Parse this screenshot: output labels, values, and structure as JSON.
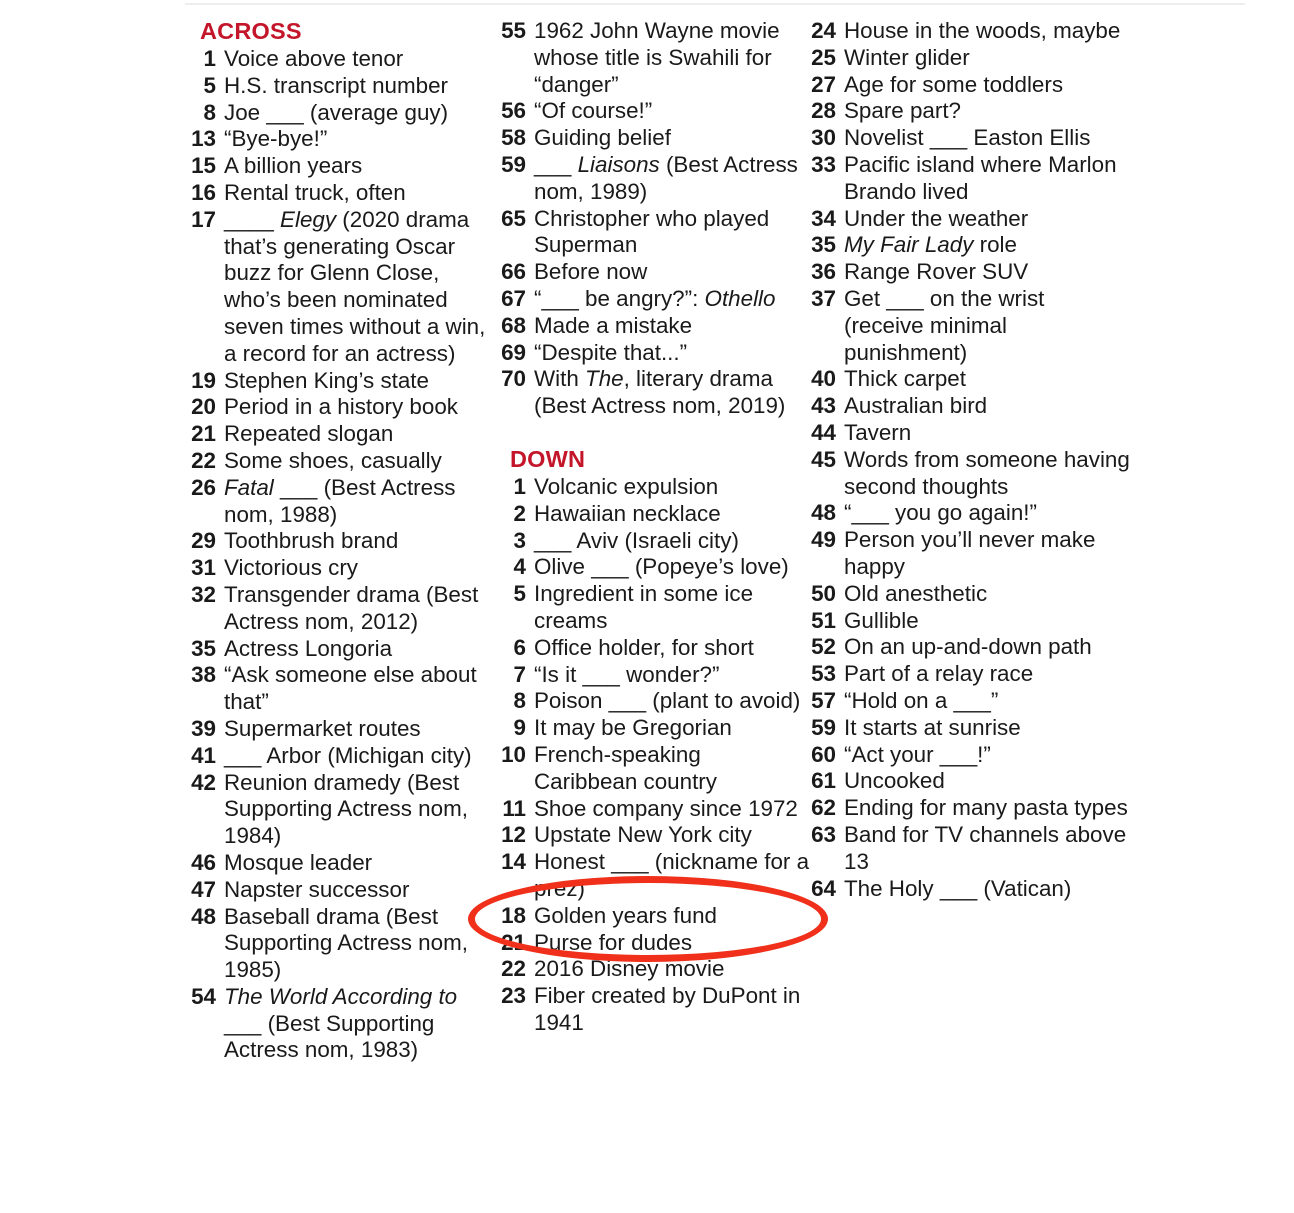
{
  "document": {
    "type": "crossword-clue-list",
    "accent_color": "#C4162B",
    "highlight_color": "#F0301A",
    "text_color": "#1a1a1a",
    "background_color": "#ffffff"
  },
  "columns": [
    {
      "id": "column-1",
      "sections": [
        {
          "heading": "ACROSS",
          "clues": [
            {
              "num": "1",
              "text": "Voice above tenor"
            },
            {
              "num": "5",
              "text": "H.S. transcript number"
            },
            {
              "num": "8",
              "text": "Joe ___ (average guy)"
            },
            {
              "num": "13",
              "text": "“Bye-bye!”"
            },
            {
              "num": "15",
              "text": "A billion years"
            },
            {
              "num": "16",
              "text": "Rental truck, often"
            },
            {
              "num": "17",
              "text": "____ Elegy (2020 drama that’s generating Oscar buzz for Glenn Close, who’s been nominated seven times without a win, a record for an actress)",
              "italic": "Elegy"
            },
            {
              "num": "19",
              "text": "Stephen King’s state"
            },
            {
              "num": "20",
              "text": "Period in a history book"
            },
            {
              "num": "21",
              "text": "Repeated slogan"
            },
            {
              "num": "22",
              "text": "Some shoes, casually"
            },
            {
              "num": "26",
              "text": "Fatal ___ (Best Actress nom, 1988)",
              "italic": "Fatal"
            },
            {
              "num": "29",
              "text": "Toothbrush brand"
            },
            {
              "num": "31",
              "text": "Victorious cry"
            },
            {
              "num": "32",
              "text": "Transgender drama (Best Actress nom, 2012)"
            },
            {
              "num": "35",
              "text": "Actress Longoria"
            },
            {
              "num": "38",
              "text": "“Ask someone else about that”"
            },
            {
              "num": "39",
              "text": "Supermarket routes"
            },
            {
              "num": "41",
              "text": "___ Arbor (Michigan city)"
            },
            {
              "num": "42",
              "text": "Reunion dramedy (Best Supporting Actress nom, 1984)"
            },
            {
              "num": "46",
              "text": "Mosque leader"
            },
            {
              "num": "47",
              "text": "Napster successor"
            },
            {
              "num": "48",
              "text": "Baseball drama (Best Supporting Actress nom, 1985)"
            },
            {
              "num": "54",
              "text": "The World According to ___ (Best Supporting Actress nom, 1983)",
              "italic": "The World According to"
            }
          ]
        }
      ]
    },
    {
      "id": "column-2",
      "sections": [
        {
          "heading": "",
          "clues": [
            {
              "num": "55",
              "text": "1962 John Wayne movie whose title is Swahili for “danger”"
            },
            {
              "num": "56",
              "text": "“Of course!”"
            },
            {
              "num": "58",
              "text": "Guiding belief"
            },
            {
              "num": "59",
              "text": "___ Liaisons (Best Actress nom, 1989)",
              "italic": "Liaisons"
            },
            {
              "num": "65",
              "text": "Christopher who played Superman"
            },
            {
              "num": "66",
              "text": "Before now"
            },
            {
              "num": "67",
              "text": "“___ be angry?”: Othello",
              "italic": "Othello"
            },
            {
              "num": "68",
              "text": "Made a mistake"
            },
            {
              "num": "69",
              "text": "“Despite that...”"
            },
            {
              "num": "70",
              "text": "With The, literary drama (Best Actress nom, 2019)",
              "italic": "The"
            }
          ]
        },
        {
          "heading": "DOWN",
          "clues": [
            {
              "num": "1",
              "text": "Volcanic expulsion"
            },
            {
              "num": "2",
              "text": "Hawaiian necklace"
            },
            {
              "num": "3",
              "text": "___ Aviv (Israeli city)"
            },
            {
              "num": "4",
              "text": "Olive ___ (Popeye’s love)"
            },
            {
              "num": "5",
              "text": "Ingredient in some ice creams"
            },
            {
              "num": "6",
              "text": "Office holder, for short"
            },
            {
              "num": "7",
              "text": "“Is it ___ wonder?”"
            },
            {
              "num": "8",
              "text": "Poison ___ (plant to avoid)"
            },
            {
              "num": "9",
              "text": "It may be Gregorian"
            },
            {
              "num": "10",
              "text": "French-speaking Caribbean country"
            },
            {
              "num": "11",
              "text": "Shoe company since 1972",
              "highlighted": true
            },
            {
              "num": "12",
              "text": "Upstate New York city"
            },
            {
              "num": "14",
              "text": "Honest ___ (nickname for a prez)"
            },
            {
              "num": "18",
              "text": "Golden years fund"
            },
            {
              "num": "21",
              "text": "Purse for dudes"
            },
            {
              "num": "22",
              "text": "2016 Disney movie"
            },
            {
              "num": "23",
              "text": "Fiber created by DuPont in 1941"
            }
          ]
        }
      ]
    },
    {
      "id": "column-3",
      "sections": [
        {
          "heading": "",
          "clues": [
            {
              "num": "24",
              "text": "House in the woods, maybe"
            },
            {
              "num": "25",
              "text": "Winter glider"
            },
            {
              "num": "27",
              "text": "Age for some toddlers"
            },
            {
              "num": "28",
              "text": "Spare part?"
            },
            {
              "num": "30",
              "text": "Novelist ___ Easton Ellis"
            },
            {
              "num": "33",
              "text": "Pacific island where Marlon Brando lived"
            },
            {
              "num": "34",
              "text": "Under the weather"
            },
            {
              "num": "35",
              "text": "My Fair Lady role",
              "italic": "My Fair Lady"
            },
            {
              "num": "36",
              "text": "Range Rover SUV"
            },
            {
              "num": "37",
              "text": "Get ___ on the wrist (receive minimal punishment)"
            },
            {
              "num": "40",
              "text": "Thick carpet"
            },
            {
              "num": "43",
              "text": "Australian bird"
            },
            {
              "num": "44",
              "text": "Tavern"
            },
            {
              "num": "45",
              "text": "Words from someone having second thoughts"
            },
            {
              "num": "48",
              "text": "“___ you go again!”"
            },
            {
              "num": "49",
              "text": "Person you’ll never make happy"
            },
            {
              "num": "50",
              "text": "Old anesthetic"
            },
            {
              "num": "51",
              "text": "Gullible"
            },
            {
              "num": "52",
              "text": "On an up-and-down path"
            },
            {
              "num": "53",
              "text": "Part of a relay race"
            },
            {
              "num": "57",
              "text": "“Hold on a ___”"
            },
            {
              "num": "59",
              "text": "It starts at sunrise"
            },
            {
              "num": "60",
              "text": "“Act your ___!”"
            },
            {
              "num": "61",
              "text": "Uncooked"
            },
            {
              "num": "62",
              "text": "Ending for many pasta types"
            },
            {
              "num": "63",
              "text": "Band for TV channels above 13"
            },
            {
              "num": "64",
              "text": "The Holy ___ (Vatican)"
            }
          ]
        }
      ]
    }
  ],
  "annotation": {
    "type": "ellipse-highlight",
    "target_clue_num": "11",
    "target_clue_text": "Shoe company since 1972",
    "color": "#F0301A"
  }
}
